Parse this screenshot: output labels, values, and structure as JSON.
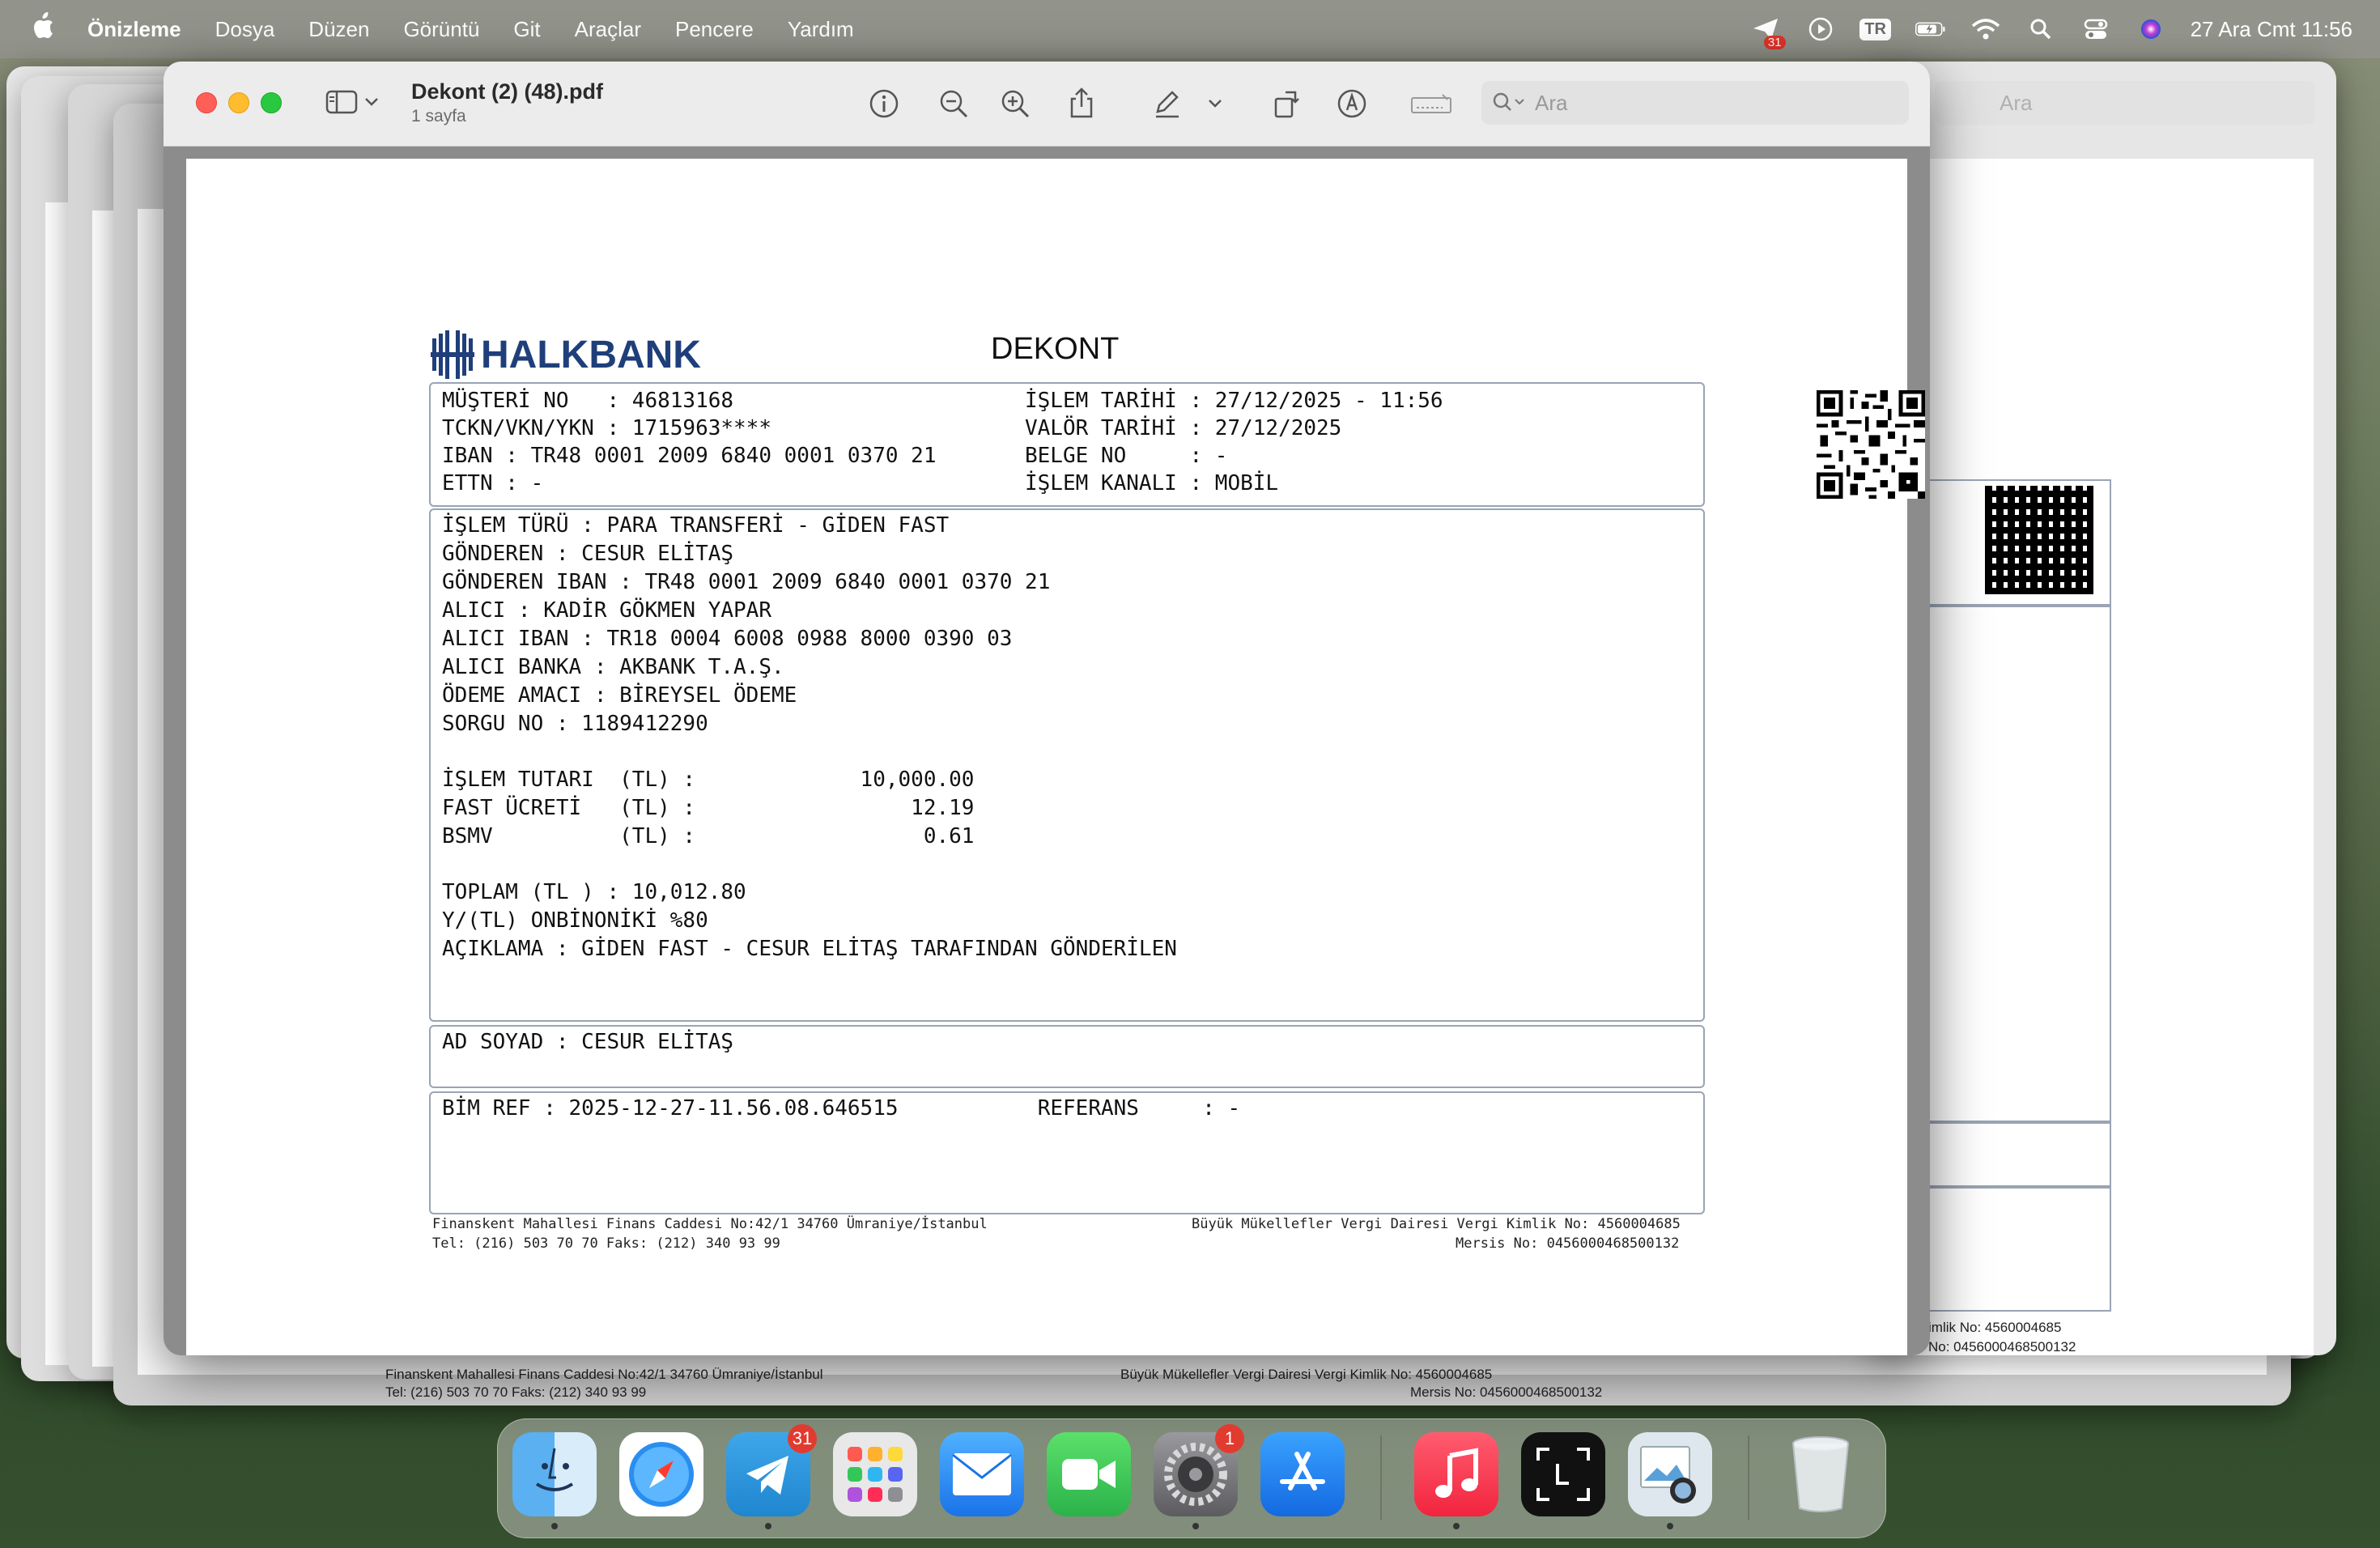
{
  "menubar": {
    "app_name": "Önizleme",
    "items": [
      "Dosya",
      "Düzen",
      "Görüntü",
      "Git",
      "Araçlar",
      "Pencere",
      "Yardım"
    ],
    "input_source": "TR",
    "mail_badge": "31",
    "clock": "27 Ara Cmt  11:56"
  },
  "window": {
    "title": "Dekont (2) (48).pdf",
    "subtitle": "1 sayfa",
    "search_placeholder": "Ara"
  },
  "bg_window": {
    "search_placeholder": "Ara",
    "footer_line1_right": "imlik No: 4560004685",
    "footer_line2_right": "No: 0456000468500132"
  },
  "document": {
    "logo": "HALKBANK",
    "heading": "DEKONT",
    "header_left": [
      "MÜŞTERİ NO   : 46813168",
      "TCKN/VKN/YKN : 1715963****",
      "IBAN : TR48 0001 2009 6840 0001 0370 21",
      "ETTN : -"
    ],
    "header_right": [
      "İŞLEM TARİHİ : 27/12/2025 - 11:56",
      "VALÖR TARİHİ : 27/12/2025",
      "BELGE NO     : -",
      "İŞLEM KANALI : MOBİL"
    ],
    "body_lines": [
      "İŞLEM TÜRÜ : PARA TRANSFERİ - GİDEN FAST",
      "GÖNDEREN : CESUR ELİTAŞ",
      "GÖNDEREN IBAN : TR48 0001 2009 6840 0001 0370 21",
      "ALICI : KADİR GÖKMEN YAPAR",
      "ALICI IBAN : TR18 0004 6008 0988 8000 0390 03",
      "ALICI BANKA : AKBANK T.A.Ş.",
      "ÖDEME AMACI : BİREYSEL ÖDEME",
      "SORGU NO : 1189412290"
    ],
    "amount_lines": [
      "İŞLEM TUTARI  (TL) :             10,000.00",
      "FAST ÜCRETİ   (TL) :                 12.19",
      "BSMV          (TL) :                  0.61"
    ],
    "total_lines": [
      "TOPLAM (TL ) : 10,012.80",
      "Y/(TL) ONBİNONİKİ %80",
      "AÇIKLAMA : GİDEN FAST - CESUR ELİTAŞ TARAFINDAN GÖNDERİLEN"
    ],
    "name_line": "AD SOYAD : CESUR ELİTAŞ",
    "ref_line": "BİM REF : 2025-12-27-11.56.08.646515           REFERANS     : -",
    "footer_left_1": "Finanskent Mahallesi Finans Caddesi No:42/1 34760 Ümraniye/İstanbul",
    "footer_left_2": "Tel: (216) 503 70 70 Faks: (212) 340 93 99",
    "footer_right_1": "Büyük Mükellefler Vergi Dairesi Vergi Kimlik No: 4560004685",
    "footer_right_2": "Mersis No: 0456000468500132"
  },
  "dock": {
    "apps": [
      {
        "name": "Finder",
        "badge": ""
      },
      {
        "name": "Safari",
        "badge": ""
      },
      {
        "name": "Telegram",
        "badge": "31"
      },
      {
        "name": "Launchpad",
        "badge": ""
      },
      {
        "name": "Mail",
        "badge": ""
      },
      {
        "name": "FaceTime",
        "badge": ""
      },
      {
        "name": "System Settings",
        "badge": "1"
      },
      {
        "name": "App Store",
        "badge": ""
      },
      {
        "name": "Music",
        "badge": ""
      },
      {
        "name": "Screenshot",
        "badge": ""
      },
      {
        "name": "Preview",
        "badge": ""
      },
      {
        "name": "Trash",
        "badge": ""
      }
    ]
  },
  "colors": {
    "halkbank_blue": "#1f3f7a",
    "box_border": "#9aa4b3",
    "badge_red": "#e13b30"
  }
}
